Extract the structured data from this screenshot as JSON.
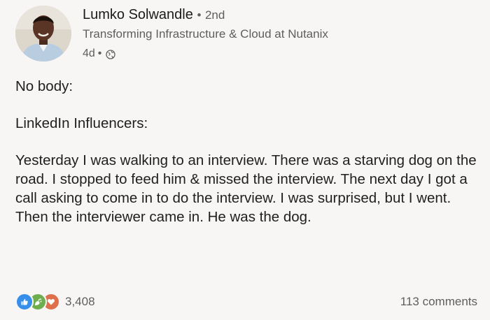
{
  "author": {
    "name": "Lumko Solwandle",
    "separator": "•",
    "degree": "2nd",
    "headline": "Transforming Infrastructure & Cloud at Nutanix",
    "time": "4d",
    "meta_separator": "•",
    "visibility_icon": "globe-icon"
  },
  "post": {
    "paragraphs": [
      "No body:",
      "LinkedIn Influencers:",
      "Yesterday I was walking to an interview. There was a starving dog on the road. I stopped to feed him & missed the interview. The next day I got a call asking to come in to do the interview. I was surprised, but I went. Then the interviewer came in. He was the dog."
    ]
  },
  "social": {
    "reaction_icons": [
      "like-icon",
      "celebrate-icon",
      "love-icon"
    ],
    "reaction_count": "3,408",
    "comments": "113 comments"
  },
  "colors": {
    "background": "#f7f6f4",
    "like": "#378fe9",
    "celebrate": "#6dae4f",
    "love": "#df704d",
    "secondary_text": "#5e5e5e"
  }
}
